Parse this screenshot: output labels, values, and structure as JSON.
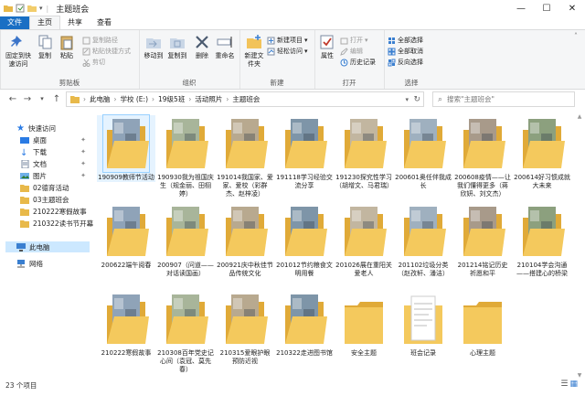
{
  "window": {
    "title": "主题班会"
  },
  "ribbon_tabs": [
    "文件",
    "主页",
    "共享",
    "查看"
  ],
  "ribbon": {
    "clipboard": {
      "label": "剪贴板",
      "pin_quick": "固定到快速访问",
      "copy": "复制",
      "paste": "粘贴",
      "copy_path": "复制路径",
      "paste_shortcut": "粘贴快捷方式",
      "cut": "剪切"
    },
    "organize": {
      "label": "组织",
      "move_to": "移动到",
      "copy_to": "复制到",
      "delete": "删除",
      "rename": "重命名"
    },
    "new": {
      "label": "新建",
      "new_folder": "新建文件夹",
      "new_item": "新建项目",
      "easy_access": "轻松访问"
    },
    "open": {
      "label": "打开",
      "properties": "属性",
      "open": "打开",
      "edit": "编辑",
      "history": "历史记录"
    },
    "select": {
      "label": "选择",
      "select_all": "全部选择",
      "select_none": "全部取消",
      "invert": "反向选择"
    }
  },
  "address": {
    "crumbs": [
      "此电脑",
      "学校 (E:)",
      "19级5班",
      "活动照片",
      "主题班会"
    ],
    "search_placeholder": "搜索\"主题班会\""
  },
  "nav": {
    "quick_access": "快速访问",
    "items": [
      "桌面",
      "下载",
      "文档",
      "图片",
      "02德育活动",
      "03主题班会",
      "210222寒假故事",
      "210322读书节开幕"
    ],
    "this_pc": "此电脑",
    "network": "网络"
  },
  "files": [
    "190909教师节活动",
    "190930我为祖国庆生（规金丽、田栩婷）",
    "191014我国家、爱家、爱校（彩群杰、赵梓凌）",
    "191118学习经验交流分享",
    "191230探究性学习（胡增文、马君瑞）",
    "200601奥任伴我成长",
    "200608疫情——让我们懂得更多（蒋欣妍、刘文杰）",
    "200614好习惯成就大未来",
    "200622端午阅春",
    "200907（问道——对话读国画）",
    "200921庆中秋佳节 品传统文化",
    "201012节约粮食文明用餐",
    "201026展在重阳关爱老人",
    "201102垃圾分类（赵孜轩、潘洁）",
    "201214铭记历史 祈愿和平",
    "210104学会沟通——搭建心的桥梁",
    "210222寒假故事",
    "210308百年党史记心间（袁冠、莫先春）",
    "210315爱眼护眼 预防近视",
    "210322走进图书馆",
    "安全主题",
    "班会记录",
    "心理主题"
  ],
  "status": {
    "count": "23 个项目"
  }
}
